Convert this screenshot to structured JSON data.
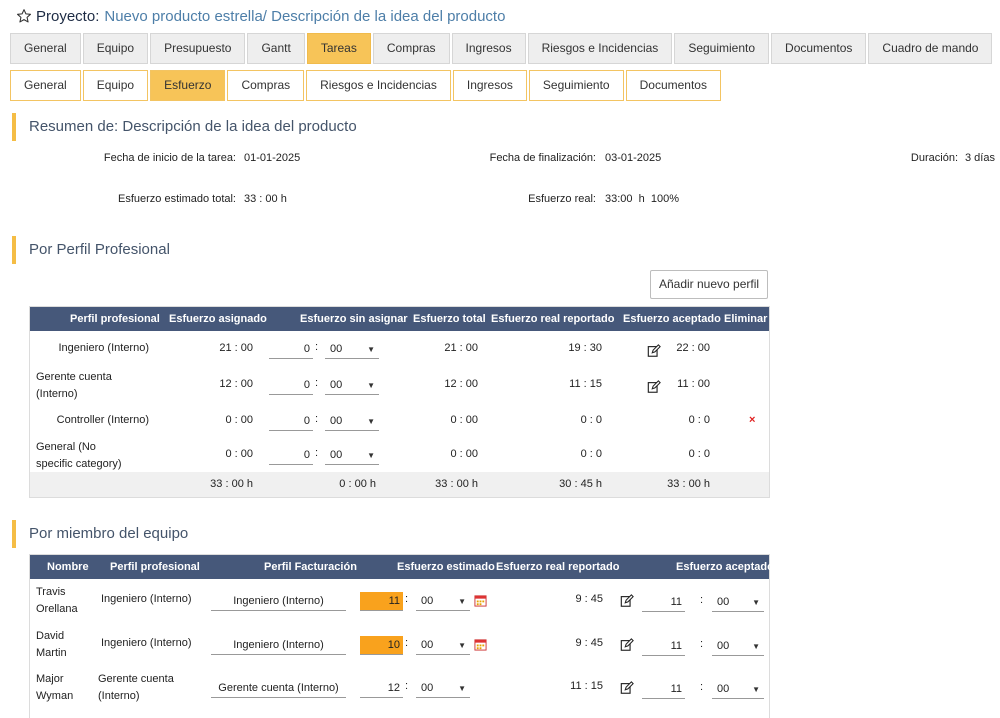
{
  "header": {
    "label": "Proyecto:",
    "project": "Nuevo producto estrella/ Descripción de la idea del producto"
  },
  "tabs_main": [
    "General",
    "Equipo",
    "Presupuesto",
    "Gantt",
    "Tareas",
    "Compras",
    "Ingresos",
    "Riesgos e Incidencias",
    "Seguimiento",
    "Documentos",
    "Cuadro de mando"
  ],
  "tabs_main_active": "Tareas",
  "tabs_sub": [
    "General",
    "Equipo",
    "Esfuerzo",
    "Compras",
    "Riesgos e Incidencias",
    "Ingresos",
    "Seguimiento",
    "Documentos"
  ],
  "tabs_sub_active": "Esfuerzo",
  "summary": {
    "title": "Resumen de: Descripción de la idea del producto",
    "start_label": "Fecha de inicio de la tarea:",
    "start_value": "01-01-2025",
    "end_label": "Fecha de finalización:",
    "end_value": "03-01-2025",
    "duration_label": "Duración:",
    "duration_value": "3 días",
    "est_label": "Esfuerzo estimado total:",
    "est_value": "33 : 00 h",
    "real_label": "Esfuerzo real:",
    "real_value": "33:00  h  100%"
  },
  "profiles": {
    "title": "Por Perfil Profesional",
    "add_button": "Añadir nuevo perfil",
    "headers": [
      "Perfil profesional",
      "Esfuerzo asignado",
      "Esfuerzo sin asignar",
      "Esfuerzo total",
      "Esfuerzo real reportado",
      "Esfuerzo aceptado",
      "Eliminar"
    ],
    "rows": [
      {
        "profile": "Ingeniero (Interno)",
        "assigned": "21 : 00",
        "unassigned_h": "0",
        "unassigned_m": "00",
        "total": "21 : 00",
        "real": "19 : 30",
        "accepted": "22 : 00",
        "editable": true,
        "deletable": false
      },
      {
        "profile": "Gerente cuenta (Interno)",
        "assigned": "12 : 00",
        "unassigned_h": "0",
        "unassigned_m": "00",
        "total": "12 : 00",
        "real": "11 : 15",
        "accepted": "11 : 00",
        "editable": true,
        "deletable": false
      },
      {
        "profile": "Controller (Interno)",
        "assigned": "0 : 00",
        "unassigned_h": "0",
        "unassigned_m": "00",
        "total": "0 : 00",
        "real": "0 : 0",
        "accepted": "0 : 0",
        "editable": false,
        "deletable": true
      },
      {
        "profile": "General (No specific category)",
        "assigned": "0 : 00",
        "unassigned_h": "0",
        "unassigned_m": "00",
        "total": "0 : 00",
        "real": "0 : 0",
        "accepted": "0 : 0",
        "editable": false,
        "deletable": false
      }
    ],
    "totals": {
      "assigned": "33 : 00 h",
      "unassigned": "0 : 00 h",
      "total": "33 : 00 h",
      "real": "30 : 45 h",
      "accepted": "33 : 00 h"
    },
    "delete_glyph": "×"
  },
  "members": {
    "title": "Por miembro del equipo",
    "headers": [
      "Nombre",
      "Perfil profesional",
      "Perfil Facturación",
      "Esfuerzo estimado",
      "Esfuerzo real reportado",
      "Esfuerzo aceptado"
    ],
    "rows": [
      {
        "name": "Travis Orellana",
        "profile": "Ingeniero (Interno)",
        "billing": "Ingeniero (Interno)",
        "est_h": "11",
        "est_m": "00",
        "highlight": true,
        "real": "9 : 45",
        "acc_h": "11",
        "acc_m": "00"
      },
      {
        "name": "David Martin",
        "profile": "Ingeniero (Interno)",
        "billing": "Ingeniero (Interno)",
        "est_h": "10",
        "est_m": "00",
        "highlight": true,
        "real": "9 : 45",
        "acc_h": "11",
        "acc_m": "00"
      },
      {
        "name": "Major Wyman",
        "profile": "Gerente cuenta (Interno)",
        "billing": "Gerente cuenta (Interno)",
        "est_h": "12",
        "est_m": "00",
        "highlight": false,
        "real": "11 : 15",
        "acc_h": "11",
        "acc_m": "00"
      }
    ],
    "separator": ":"
  },
  "colors": {
    "accent": "#f7c458",
    "table_header": "#46587a",
    "highlight": "#f9a21d",
    "delete": "#e02020"
  }
}
